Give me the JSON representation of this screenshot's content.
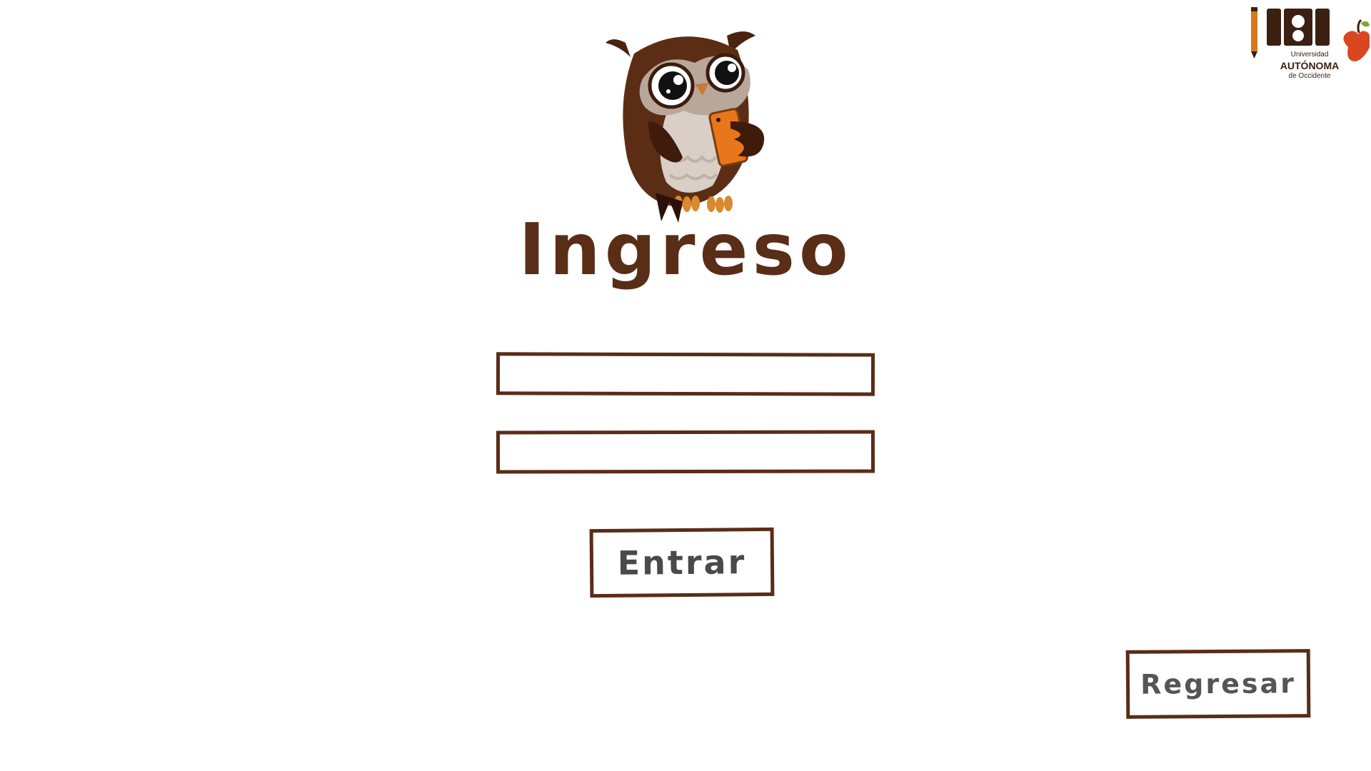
{
  "page": {
    "title": "Ingreso"
  },
  "form": {
    "username_value": "",
    "password_value": "",
    "enter_label": "Entrar"
  },
  "navigation": {
    "back_label": "Regresar"
  },
  "logo": {
    "line1": "Universidad",
    "line2": "AUTÓNOMA",
    "line3": "de Occidente"
  },
  "colors": {
    "primary_brown": "#5a2d17",
    "button_text": "#4a4a4a",
    "background": "#ffffff",
    "accent_orange": "#e8761a"
  }
}
